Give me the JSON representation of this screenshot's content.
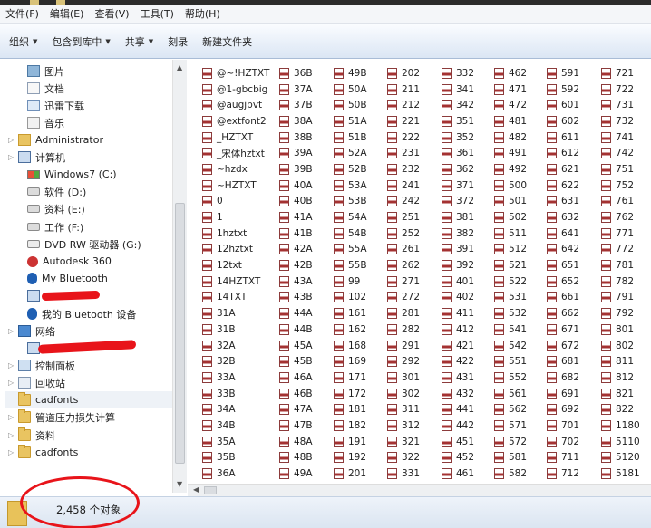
{
  "menubar": [
    "文件(F)",
    "编辑(E)",
    "查看(V)",
    "工具(T)",
    "帮助(H)"
  ],
  "toolbar": [
    {
      "label": "组织",
      "has_dropdown": true
    },
    {
      "label": "包含到库中",
      "has_dropdown": true
    },
    {
      "label": "共享",
      "has_dropdown": true
    },
    {
      "label": "刻录",
      "has_dropdown": false
    },
    {
      "label": "新建文件夹",
      "has_dropdown": false
    }
  ],
  "nav": [
    {
      "label": "图片",
      "icon": "picture-icon",
      "indent": 1
    },
    {
      "label": "文档",
      "icon": "document-icon",
      "indent": 1
    },
    {
      "label": "迅雷下载",
      "icon": "download-icon",
      "indent": 1
    },
    {
      "label": "音乐",
      "icon": "music-icon",
      "indent": 1
    },
    {
      "label": "Administrator",
      "icon": "user-folder-icon",
      "indent": 0
    },
    {
      "label": "计算机",
      "icon": "computer-icon",
      "indent": 0
    },
    {
      "label": "Windows7 (C:)",
      "icon": "windows-drive-icon",
      "indent": 1
    },
    {
      "label": "软件 (D:)",
      "icon": "drive-icon",
      "indent": 1
    },
    {
      "label": "资料 (E:)",
      "icon": "drive-icon",
      "indent": 1
    },
    {
      "label": "工作 (F:)",
      "icon": "drive-icon",
      "indent": 1
    },
    {
      "label": "DVD RW 驱动器 (G:)",
      "icon": "dvd-drive-icon",
      "indent": 1
    },
    {
      "label": "Autodesk 360",
      "icon": "autodesk-360-icon",
      "indent": 1
    },
    {
      "label": "My Bluetooth",
      "icon": "bluetooth-icon",
      "indent": 1
    },
    {
      "label": "",
      "icon": "device-icon",
      "indent": 1
    },
    {
      "label": "我的 Bluetooth 设备",
      "icon": "bluetooth-icon",
      "indent": 1
    },
    {
      "label": "网络",
      "icon": "network-icon",
      "indent": 0
    },
    {
      "label": "",
      "icon": "network-computer-icon",
      "indent": 1
    },
    {
      "label": "控制面板",
      "icon": "control-panel-icon",
      "indent": 0
    },
    {
      "label": "回收站",
      "icon": "recycle-bin-icon",
      "indent": 0
    },
    {
      "label": "cadfonts",
      "icon": "folder-icon",
      "indent": 0,
      "selected": true
    },
    {
      "label": "管道压力损失计算",
      "icon": "folder-icon",
      "indent": 0
    },
    {
      "label": "资料",
      "icon": "folder-icon",
      "indent": 0
    },
    {
      "label": "cadfonts",
      "icon": "folder-icon",
      "indent": 0
    }
  ],
  "files": [
    [
      "@~!HZTXT",
      "@1-gbcbig",
      "@augjpvt",
      "@extfont2",
      "_HZTXT",
      "_宋体hztxt",
      "~hzdx",
      "~HZTXT",
      "0",
      "1",
      "1hztxt",
      "12hztxt",
      "12txt",
      "14HZTXT",
      "14TXT",
      "31A",
      "31B",
      "32A",
      "32B",
      "33A",
      "33B",
      "34A",
      "34B",
      "35A",
      "35B",
      "36A"
    ],
    [
      "36B",
      "37A",
      "37B",
      "38A",
      "38B",
      "39A",
      "39B",
      "40A",
      "40B",
      "41A",
      "41B",
      "42A",
      "42B",
      "43A",
      "43B",
      "44A",
      "44B",
      "45A",
      "45B",
      "46A",
      "46B",
      "47A",
      "47B",
      "48A",
      "48B",
      "49A"
    ],
    [
      "49B",
      "50A",
      "50B",
      "51A",
      "51B",
      "52A",
      "52B",
      "53A",
      "53B",
      "54A",
      "54B",
      "55A",
      "55B",
      "99",
      "102",
      "161",
      "162",
      "168",
      "169",
      "171",
      "172",
      "181",
      "182",
      "191",
      "192",
      "201"
    ],
    [
      "202",
      "211",
      "212",
      "221",
      "222",
      "231",
      "232",
      "241",
      "242",
      "251",
      "252",
      "261",
      "262",
      "271",
      "272",
      "281",
      "282",
      "291",
      "292",
      "301",
      "302",
      "311",
      "312",
      "321",
      "322",
      "331"
    ],
    [
      "332",
      "341",
      "342",
      "351",
      "352",
      "361",
      "362",
      "371",
      "372",
      "381",
      "382",
      "391",
      "392",
      "401",
      "402",
      "411",
      "412",
      "421",
      "422",
      "431",
      "432",
      "441",
      "442",
      "451",
      "452",
      "461"
    ],
    [
      "462",
      "471",
      "472",
      "481",
      "482",
      "491",
      "492",
      "500",
      "501",
      "502",
      "511",
      "512",
      "521",
      "522",
      "531",
      "532",
      "541",
      "542",
      "551",
      "552",
      "561",
      "562",
      "571",
      "572",
      "581",
      "582"
    ],
    [
      "591",
      "592",
      "601",
      "602",
      "611",
      "612",
      "621",
      "622",
      "631",
      "632",
      "641",
      "642",
      "651",
      "652",
      "661",
      "662",
      "671",
      "672",
      "681",
      "682",
      "691",
      "692",
      "701",
      "702",
      "711",
      "712"
    ],
    [
      "721",
      "722",
      "731",
      "732",
      "741",
      "742",
      "751",
      "752",
      "761",
      "762",
      "771",
      "772",
      "781",
      "782",
      "791",
      "792",
      "801",
      "802",
      "811",
      "812",
      "821",
      "822",
      "1180",
      "5110",
      "5120",
      "5181"
    ]
  ],
  "status": {
    "count": "2,458 个对象"
  },
  "colors": {
    "annotation_red": "#e8141a",
    "file_icon_red": "#a43232"
  }
}
